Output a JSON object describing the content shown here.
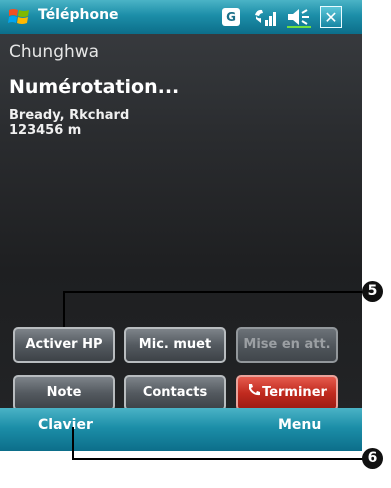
{
  "titlebar": {
    "title": "Téléphone",
    "network_indicator": "G",
    "icons": [
      "windows-start-icon",
      "signal-icon",
      "volume-icon",
      "close-icon"
    ],
    "close_label": "✕"
  },
  "call": {
    "carrier": "Chunghwa",
    "status": "Numérotation...",
    "contact_name": "Bready, Rkchard",
    "contact_number": "123456 m"
  },
  "buttons": {
    "speaker": "Activer HP",
    "mute": "Mic. muet",
    "hold": "Mise en att.",
    "note": "Note",
    "contacts": "Contacts",
    "end": "Terminer"
  },
  "softkeys": {
    "left": "Clavier",
    "right": "Menu"
  },
  "callouts": {
    "buttons_marker": "5",
    "keypad_marker": "6"
  },
  "colors": {
    "bar_top": "#4ab3c6",
    "bar_bottom": "#0c6e8a",
    "end_call_red": "#c12b1f",
    "background": "#232527"
  }
}
